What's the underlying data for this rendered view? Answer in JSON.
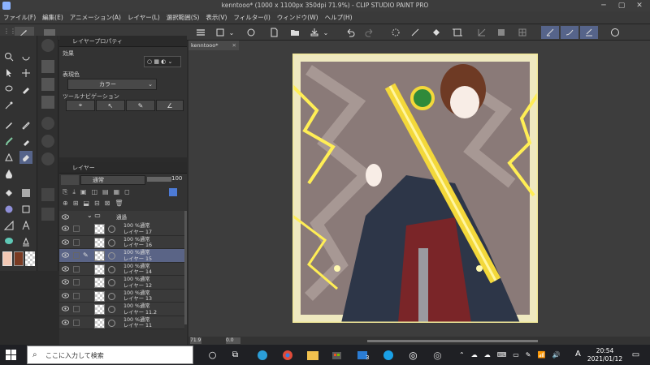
{
  "window": {
    "title": "kenntooo* (1000 x 1100px 350dpi 71.9%) - CLIP STUDIO PAINT PRO"
  },
  "menu": [
    "ファイル(F)",
    "編集(E)",
    "アニメーション(A)",
    "レイヤー(L)",
    "選択範囲(S)",
    "表示(V)",
    "フィルター(I)",
    "ウィンドウ(W)",
    "ヘルプ(H)"
  ],
  "props": {
    "tab": "レイヤープロパティ",
    "effect_label": "効果",
    "color_label": "表現色",
    "color_value": "カラー",
    "nav_label": "ツールナビゲーション"
  },
  "layers": {
    "tab": "レイヤー",
    "blend_mode": "通常",
    "opacity": "100",
    "folder_name": "通過",
    "rows": [
      {
        "pct": "100 %通常",
        "name": "レイヤー 17",
        "selected": false
      },
      {
        "pct": "100 %通常",
        "name": "レイヤー 16",
        "selected": false
      },
      {
        "pct": "100 %通常",
        "name": "レイヤー 15",
        "selected": true
      },
      {
        "pct": "100 %通常",
        "name": "レイヤー 14",
        "selected": false
      },
      {
        "pct": "100 %通常",
        "name": "レイヤー 12",
        "selected": false
      },
      {
        "pct": "100 %通常",
        "name": "レイヤー 13",
        "selected": false
      },
      {
        "pct": "100 %通常",
        "name": "レイヤー 11.2",
        "selected": false
      },
      {
        "pct": "100 %通常",
        "name": "レイヤー 11",
        "selected": false
      }
    ]
  },
  "canvas": {
    "doc_tab": "kenntooo*",
    "zoom": "71.9",
    "angle": "0.0"
  },
  "taskbar": {
    "search_placeholder": "ここに入力して検索",
    "ime": "A",
    "time": "20:54",
    "date": "2021/01/12",
    "badge": "3"
  },
  "colors": {
    "accent": "#56648a",
    "canvas_bg": "#3d3d3d",
    "main_color": "#f2c8b4",
    "sub_color": "#7a3a22"
  }
}
